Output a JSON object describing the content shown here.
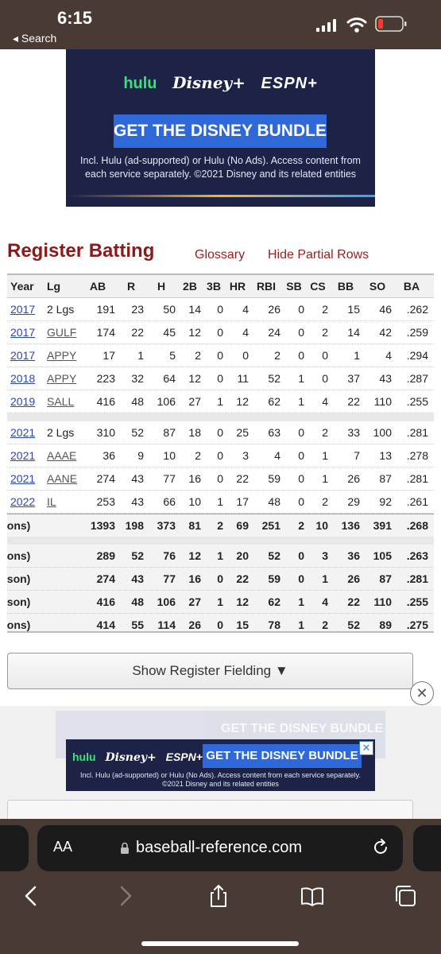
{
  "status_bar": {
    "time": "6:15",
    "back_label": "◂ Search"
  },
  "top_ad": {
    "logos": {
      "hulu": "hulu",
      "disney": "Disney+",
      "espn": "ESPN+"
    },
    "cta": "GET THE DISNEY BUNDLE",
    "fine_print": "Incl. Hulu (ad-supported) or Hulu (No Ads). Access content from each service separately. ©2021 Disney and its related entities"
  },
  "section": {
    "title": "Register Batting",
    "glossary": "Glossary",
    "hide_partial": "Hide Partial Rows"
  },
  "table": {
    "headers": [
      "Year",
      "Lg",
      "AB",
      "R",
      "H",
      "2B",
      "3B",
      "HR",
      "RBI",
      "SB",
      "CS",
      "BB",
      "SO",
      "BA"
    ],
    "rows": [
      {
        "year": "2017",
        "lg": "2 Lgs",
        "lg_link": false,
        "ab": "191",
        "r": "23",
        "h": "50",
        "d": "14",
        "t": "0",
        "hr": "4",
        "rbi": "26",
        "sb": "0",
        "cs": "2",
        "bb": "15",
        "so": "46",
        "ba": ".262"
      },
      {
        "year": "2017",
        "lg": "GULF",
        "lg_link": true,
        "ab": "174",
        "r": "22",
        "h": "45",
        "d": "12",
        "t": "0",
        "hr": "4",
        "rbi": "24",
        "sb": "0",
        "cs": "2",
        "bb": "14",
        "so": "42",
        "ba": ".259"
      },
      {
        "year": "2017",
        "lg": "APPY",
        "lg_link": true,
        "ab": "17",
        "r": "1",
        "h": "5",
        "d": "2",
        "t": "0",
        "hr": "0",
        "rbi": "2",
        "sb": "0",
        "cs": "0",
        "bb": "1",
        "so": "4",
        "ba": ".294"
      },
      {
        "year": "2018",
        "lg": "APPY",
        "lg_link": true,
        "ab": "223",
        "r": "32",
        "h": "64",
        "d": "12",
        "t": "0",
        "hr": "11",
        "rbi": "52",
        "sb": "1",
        "cs": "0",
        "bb": "37",
        "so": "43",
        "ba": ".287"
      },
      {
        "year": "2019",
        "lg": "SALL",
        "lg_link": true,
        "ab": "416",
        "r": "48",
        "h": "106",
        "d": "27",
        "t": "1",
        "hr": "12",
        "rbi": "62",
        "sb": "1",
        "cs": "4",
        "bb": "22",
        "so": "110",
        "ba": ".255"
      },
      {
        "year": "2021",
        "lg": "2 Lgs",
        "lg_link": false,
        "ab": "310",
        "r": "52",
        "h": "87",
        "d": "18",
        "t": "0",
        "hr": "25",
        "rbi": "63",
        "sb": "0",
        "cs": "2",
        "bb": "33",
        "so": "100",
        "ba": ".281"
      },
      {
        "year": "2021",
        "lg": "AAAE",
        "lg_link": true,
        "ab": "36",
        "r": "9",
        "h": "10",
        "d": "2",
        "t": "0",
        "hr": "3",
        "rbi": "4",
        "sb": "0",
        "cs": "1",
        "bb": "7",
        "so": "13",
        "ba": ".278"
      },
      {
        "year": "2021",
        "lg": "AANE",
        "lg_link": true,
        "ab": "274",
        "r": "43",
        "h": "77",
        "d": "16",
        "t": "0",
        "hr": "22",
        "rbi": "59",
        "sb": "0",
        "cs": "1",
        "bb": "26",
        "so": "87",
        "ba": ".281"
      },
      {
        "year": "2022",
        "lg": "IL",
        "lg_link": true,
        "ab": "253",
        "r": "43",
        "h": "66",
        "d": "10",
        "t": "1",
        "hr": "17",
        "rbi": "48",
        "sb": "0",
        "cs": "2",
        "bb": "29",
        "so": "92",
        "ba": ".261"
      }
    ],
    "total": {
      "label": "sons)",
      "ab": "1393",
      "r": "198",
      "h": "373",
      "d": "81",
      "t": "2",
      "hr": "69",
      "rbi": "251",
      "sb": "2",
      "cs": "10",
      "bb": "136",
      "so": "391",
      "ba": ".268"
    },
    "subtotals": [
      {
        "label": "sons)",
        "ab": "289",
        "r": "52",
        "h": "76",
        "d": "12",
        "t": "1",
        "hr": "20",
        "rbi": "52",
        "sb": "0",
        "cs": "3",
        "bb": "36",
        "so": "105",
        "ba": ".263"
      },
      {
        "label": "ason)",
        "ab": "274",
        "r": "43",
        "h": "77",
        "d": "16",
        "t": "0",
        "hr": "22",
        "rbi": "59",
        "sb": "0",
        "cs": "1",
        "bb": "26",
        "so": "87",
        "ba": ".281"
      },
      {
        "label": "ason)",
        "ab": "416",
        "r": "48",
        "h": "106",
        "d": "27",
        "t": "1",
        "hr": "12",
        "rbi": "62",
        "sb": "1",
        "cs": "4",
        "bb": "22",
        "so": "110",
        "ba": ".255"
      },
      {
        "label": "sons)",
        "ab": "414",
        "r": "55",
        "h": "114",
        "d": "26",
        "t": "0",
        "hr": "15",
        "rbi": "78",
        "sb": "1",
        "cs": "2",
        "bb": "52",
        "so": "89",
        "ba": ".275"
      }
    ]
  },
  "fielding_button": "Show Register Fielding ▼",
  "bottom_ad": {
    "ghost_cta": "GET THE DISNEY BUNDLE",
    "logos": {
      "hulu": "hulu",
      "disney": "Disney+",
      "espn": "ESPN+"
    },
    "cta": "GET THE DISNEY BUNDLE",
    "fine_print": "Incl. Hulu (ad-supported) or Hulu (No Ads). Access content from each service separately. ©2021 Disney and its related entities",
    "close": "✕"
  },
  "safari": {
    "aa_label": "AA",
    "url": "baseball-reference.com"
  },
  "colors": {
    "status_bar": "#4a3a34",
    "heading": "#8b1a1a",
    "link": "#2a47b8",
    "ad_bg": "#1c2347",
    "ad_cta": "#2f68d8"
  },
  "icons": [
    "signal-icon",
    "wifi-icon",
    "battery-icon",
    "lock-icon",
    "reload-icon",
    "back-arrow-icon",
    "forward-arrow-icon",
    "share-icon",
    "bookmarks-icon",
    "tabs-icon",
    "close-icon"
  ]
}
